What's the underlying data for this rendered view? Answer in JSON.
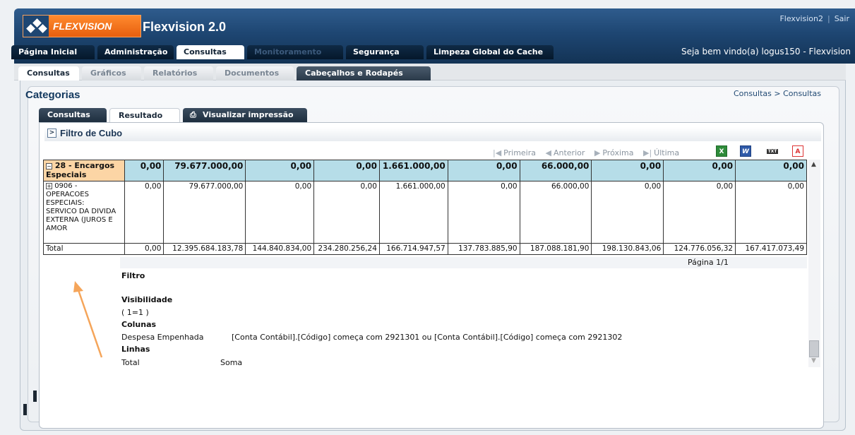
{
  "header": {
    "logo_text": "FLEXVISION",
    "app_title": "Flexvision 2.0",
    "user_link": "Flexvision2",
    "logout_link": "Sair",
    "welcome": "Seja bem vindo(a) logus150 - Flexvision"
  },
  "main_tabs": [
    {
      "label": "Página Inicial"
    },
    {
      "label": "Administração"
    },
    {
      "label": "Consultas"
    },
    {
      "label": "Monitoramento"
    },
    {
      "label": "Segurança"
    },
    {
      "label": "Limpeza Global do Cache"
    }
  ],
  "sub_tabs": [
    {
      "label": "Consultas"
    },
    {
      "label": "Gráficos"
    },
    {
      "label": "Relatórios"
    },
    {
      "label": "Documentos"
    },
    {
      "label": "Cabeçalhos e Rodapés"
    }
  ],
  "page": {
    "title": "Categorias",
    "breadcrumb": "Consultas > Consultas"
  },
  "content_tabs": [
    {
      "label": "Consultas"
    },
    {
      "label": "Resultado"
    },
    {
      "label": "Visualizar impressão"
    }
  ],
  "filter_panel": {
    "toggle": ">",
    "title": "Filtro de Cubo"
  },
  "pager": {
    "first": "Primeira",
    "previous": "Anterior",
    "next": "Próxima",
    "last": "Última",
    "page_info": "Página 1/1"
  },
  "export_icons": [
    "excel-icon",
    "word-icon",
    "text-icon",
    "pdf-icon"
  ],
  "table": {
    "group_row": {
      "toggle": "−",
      "label_line1": "28 - Encargos",
      "label_line2": "Especiais",
      "values": [
        "0,00",
        "79.677.000,00",
        "0,00",
        "0,00",
        "1.661.000,00",
        "0,00",
        "66.000,00",
        "0,00",
        "0,00",
        "0,00"
      ]
    },
    "detail_row": {
      "toggle": "+",
      "label_lines": [
        "0906 -",
        "OPERACOES",
        "ESPECIAIS:",
        "SERVICO DA DIVIDA",
        "EXTERNA (JUROS E",
        "AMOR"
      ],
      "values": [
        "0,00",
        "79.677.000,00",
        "0,00",
        "0,00",
        "1.661.000,00",
        "0,00",
        "66.000,00",
        "0,00",
        "0,00",
        "0,00"
      ]
    },
    "total_row": {
      "label": "Total",
      "values": [
        "0,00",
        "12.395.684.183,78",
        "144.840.834,00",
        "234.280.256,24",
        "166.714.947,57",
        "137.783.885,90",
        "187.088.181,90",
        "198.130.843,06",
        "124.776.056,32",
        "167.417.073,49"
      ]
    }
  },
  "details": {
    "filtro_label": "Filtro",
    "visibilidade_label": "Visibilidade",
    "visibilidade_value": "( 1=1 )",
    "colunas_label": "Colunas",
    "colunas_name": "Despesa Empenhada",
    "colunas_condition": "[Conta Contábil].[Código] começa com 2921301 ou [Conta Contábil].[Código] começa com 2921302",
    "linhas_label": "Linhas",
    "linhas_name": "Total",
    "linhas_agg": "Soma"
  },
  "colors": {
    "header_blue": "#1e4672",
    "logo_orange": "#ff7a1a",
    "group_row_blue": "#b6dde8",
    "group_label_orange": "#fcd5a5",
    "annotation_arrow": "#f5a55a"
  }
}
